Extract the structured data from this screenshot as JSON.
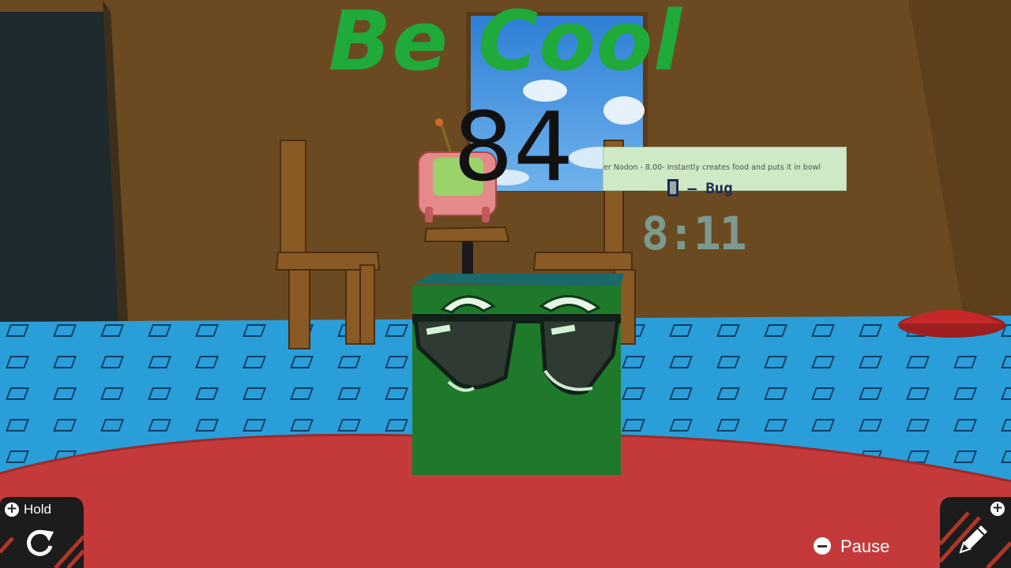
{
  "hud": {
    "title": "Be Cool",
    "counter": "84",
    "hold_label": "Hold",
    "pause_label": "Pause"
  },
  "scene": {
    "sign_text": "er Nodon - 8.00- Instantly creates food and puts it in bowl",
    "bug_label": "– Bug",
    "wall_number": "8:11"
  },
  "icons": {
    "hold": "rotate-icon",
    "pause": "minus-button-icon",
    "edit": "pencil-icon"
  },
  "colors": {
    "title": "#1faa3a",
    "floor": "#2a9ed9",
    "wall": "#6b4a22",
    "table": "#c43a3a",
    "cube": "#1e7a2a"
  }
}
